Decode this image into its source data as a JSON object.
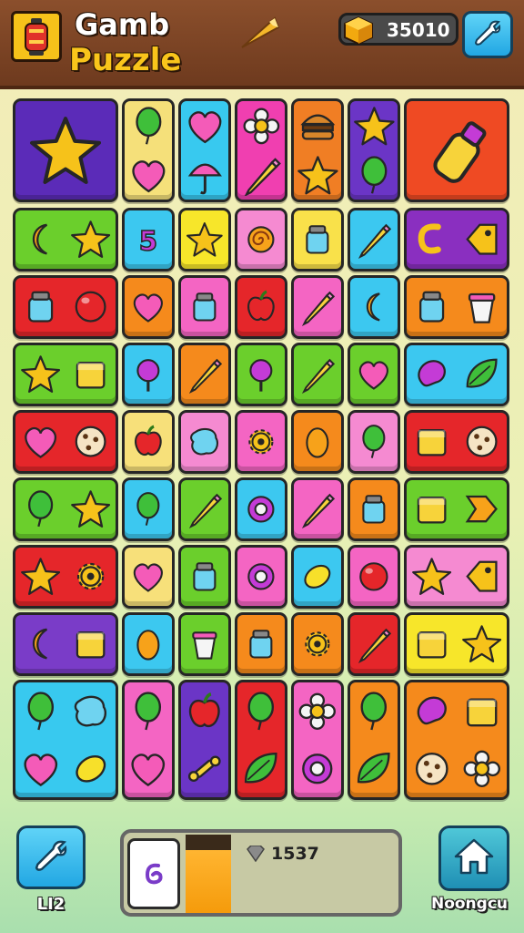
{
  "header": {
    "title_line1": "Gamb",
    "title_line2": "Puzzle",
    "coins": "35010",
    "logo_icon": "lantern-icon",
    "coin_icon": "gold-cube-icon",
    "settings_icon": "wrench-icon"
  },
  "board": {
    "rows": [
      [
        {
          "color": "#5b2bb8",
          "icons": [
            "star"
          ]
        },
        {
          "color": "#f5e07a",
          "icons": [
            "balloon",
            "heart"
          ]
        },
        {
          "color": "#38c9ef",
          "icons": [
            "heart",
            "umbrella"
          ]
        },
        {
          "color": "#f03fb0",
          "icons": [
            "flower",
            "pencil"
          ]
        },
        {
          "color": "#f07e24",
          "icons": [
            "burger",
            "star"
          ]
        },
        {
          "color": "#6b35c6",
          "icons": [
            "star",
            "balloon"
          ]
        },
        {
          "color": "#ef4a23",
          "icons": [
            "bottle"
          ]
        }
      ],
      [
        {
          "color": "#6bcf2c",
          "icons": [
            "moon",
            "star"
          ]
        },
        {
          "color": "#3cc8f0",
          "icons": [
            "number"
          ]
        },
        {
          "color": "#f7e62a",
          "icons": [
            "star"
          ]
        },
        {
          "color": "#f58ad1",
          "icons": [
            "spiral"
          ]
        },
        {
          "color": "#f9e14a",
          "icons": [
            "jar"
          ]
        },
        {
          "color": "#3cc8f0",
          "icons": [
            "pencil"
          ]
        },
        {
          "color": "#8a2fc0",
          "icons": [
            "hook",
            "tag"
          ]
        }
      ],
      [
        {
          "color": "#e5262a",
          "icons": [
            "jar",
            "ball"
          ]
        },
        {
          "color": "#f58a1c",
          "icons": [
            "heart"
          ]
        },
        {
          "color": "#f465c3",
          "icons": [
            "jar"
          ]
        },
        {
          "color": "#e5262a",
          "icons": [
            "apple"
          ]
        },
        {
          "color": "#f465c3",
          "icons": [
            "pencil"
          ]
        },
        {
          "color": "#3cc8f0",
          "icons": [
            "moon"
          ]
        },
        {
          "color": "#f58a1c",
          "icons": [
            "jar",
            "cup"
          ]
        }
      ],
      [
        {
          "color": "#6bcf2c",
          "icons": [
            "star",
            "box"
          ]
        },
        {
          "color": "#3cc8f0",
          "icons": [
            "lollipop"
          ]
        },
        {
          "color": "#f58a1c",
          "icons": [
            "pencil"
          ]
        },
        {
          "color": "#6bcf2c",
          "icons": [
            "lollipop"
          ]
        },
        {
          "color": "#6bcf2c",
          "icons": [
            "pencil"
          ]
        },
        {
          "color": "#6bcf2c",
          "icons": [
            "heart"
          ]
        },
        {
          "color": "#3cc8f0",
          "icons": [
            "bean",
            "leaf"
          ]
        }
      ],
      [
        {
          "color": "#e5262a",
          "icons": [
            "heart",
            "cookie"
          ]
        },
        {
          "color": "#f7e07a",
          "icons": [
            "apple"
          ]
        },
        {
          "color": "#f58ad1",
          "icons": [
            "blob"
          ]
        },
        {
          "color": "#f465c3",
          "icons": [
            "gear"
          ]
        },
        {
          "color": "#f58a1c",
          "icons": [
            "egg"
          ]
        },
        {
          "color": "#f58ad1",
          "icons": [
            "balloon"
          ]
        },
        {
          "color": "#e5262a",
          "icons": [
            "box",
            "cookie"
          ]
        }
      ],
      [
        {
          "color": "#6bcf2c",
          "icons": [
            "balloon",
            "star"
          ]
        },
        {
          "color": "#3cc8f0",
          "icons": [
            "balloon"
          ]
        },
        {
          "color": "#6bcf2c",
          "icons": [
            "pencil"
          ]
        },
        {
          "color": "#3cc8f0",
          "icons": [
            "ring"
          ]
        },
        {
          "color": "#f465c3",
          "icons": [
            "pencil"
          ]
        },
        {
          "color": "#f58a1c",
          "icons": [
            "jar"
          ]
        },
        {
          "color": "#6bcf2c",
          "icons": [
            "box",
            "arrow"
          ]
        }
      ],
      [
        {
          "color": "#e5262a",
          "icons": [
            "star",
            "gear"
          ]
        },
        {
          "color": "#f7e07a",
          "icons": [
            "heart"
          ]
        },
        {
          "color": "#6bcf2c",
          "icons": [
            "jar"
          ]
        },
        {
          "color": "#f465c3",
          "icons": [
            "ring"
          ]
        },
        {
          "color": "#3cc8f0",
          "icons": [
            "lemon"
          ]
        },
        {
          "color": "#f465c3",
          "icons": [
            "ball"
          ]
        },
        {
          "color": "#f58ad1",
          "icons": [
            "star",
            "tag"
          ]
        }
      ],
      [
        {
          "color": "#7a3cc8",
          "icons": [
            "moon",
            "box"
          ]
        },
        {
          "color": "#3cc8f0",
          "icons": [
            "egg"
          ]
        },
        {
          "color": "#6bcf2c",
          "icons": [
            "cup"
          ]
        },
        {
          "color": "#f58a1c",
          "icons": [
            "jar"
          ]
        },
        {
          "color": "#f58a1c",
          "icons": [
            "gear"
          ]
        },
        {
          "color": "#e5262a",
          "icons": [
            "pencil"
          ]
        },
        {
          "color": "#f7e62a",
          "icons": [
            "box",
            "star"
          ]
        }
      ],
      [
        {
          "color": "#38c9ef",
          "icons": [
            "balloon",
            "blob",
            "heart",
            "lemon"
          ]
        },
        {
          "color": "#f465c3",
          "icons": [
            "balloon",
            "heart"
          ]
        },
        {
          "color": "#6b35c6",
          "icons": [
            "apple",
            "bone"
          ]
        },
        {
          "color": "#e5262a",
          "icons": [
            "balloon",
            "leaf"
          ]
        },
        {
          "color": "#f465c3",
          "icons": [
            "flower",
            "ring"
          ]
        },
        {
          "color": "#f58a1c",
          "icons": [
            "balloon",
            "leaf"
          ]
        },
        {
          "color": "#f58a1c",
          "icons": [
            "bean",
            "box",
            "cookie",
            "flower"
          ]
        }
      ]
    ]
  },
  "bottom": {
    "left_label": "LI2",
    "left_icon": "wrench-icon",
    "panel_value": "1537",
    "panel_progress": 0.8,
    "panel_card_icon": "swirl-card-icon",
    "panel_gem_icon": "gem-icon",
    "right_label": "Noongcu",
    "right_icon": "home-icon"
  }
}
